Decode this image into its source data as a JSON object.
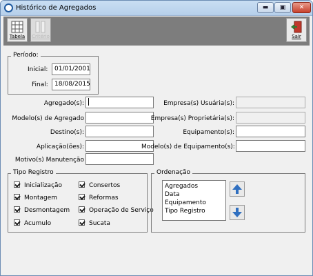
{
  "window": {
    "title": "Histórico de Agregados"
  },
  "caption_buttons": {
    "minimize": "▬",
    "maximize": "▣",
    "close": "✕"
  },
  "toolbar": {
    "tabela_label": "Tabela",
    "criterio_label": "Critério",
    "sair_label": "Sair"
  },
  "periodo": {
    "title": "Período:",
    "inicial_label": "Inicial:",
    "inicial_value": "01/01/2001",
    "final_label": "Final:",
    "final_value": "18/08/2015"
  },
  "filters": {
    "agregados": {
      "label": "Agregado(s):",
      "value": ""
    },
    "modelos_agregado": {
      "label": "Modelo(s) de Agregado",
      "value": ""
    },
    "destino": {
      "label": "Destino(s):",
      "value": ""
    },
    "aplicacao": {
      "label": "Aplicação(ões):",
      "value": ""
    },
    "motivo": {
      "label": "Motivo(s) Manutenção",
      "value": ""
    },
    "empresa_usuaria": {
      "label": "Empresa(s) Usuária(s):",
      "value": ""
    },
    "empresa_proprietaria": {
      "label": "Empresa(s) Proprietária(s):",
      "value": ""
    },
    "equipamento": {
      "label": "Equipamento(s):",
      "value": ""
    },
    "modelo_equipamento": {
      "label": "Modelo(s) de Equipamento(s):",
      "value": ""
    }
  },
  "tipo_registro": {
    "title": "Tipo Registro",
    "items": [
      {
        "label": "Inicialização",
        "checked": true
      },
      {
        "label": "Consertos",
        "checked": true
      },
      {
        "label": "Montagem",
        "checked": true
      },
      {
        "label": "Reformas",
        "checked": true
      },
      {
        "label": "Desmontagem",
        "checked": true
      },
      {
        "label": "Operação de Serviço",
        "checked": true
      },
      {
        "label": "Acumulo",
        "checked": true
      },
      {
        "label": "Sucata",
        "checked": true
      }
    ]
  },
  "ordenacao": {
    "title": "Ordenação",
    "items": [
      "Agregados",
      "Data",
      "Equipamento",
      "Tipo Registro"
    ]
  },
  "colors": {
    "arrow_blue": "#2f6fc0",
    "toolbar_bg": "#7d7d7d",
    "window_bg": "#f0f0f0"
  }
}
